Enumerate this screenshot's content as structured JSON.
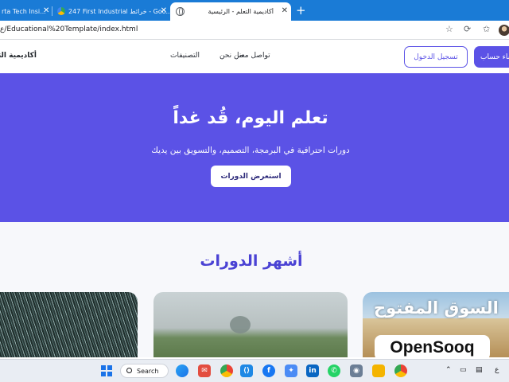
{
  "browser": {
    "tabs": [
      {
        "title": "rta Tech Insi...",
        "active": false
      },
      {
        "title": "247 First Industrial خرائط - Goo...",
        "active": false
      },
      {
        "title": "أكاديمية التعلم - الرئيسية",
        "active": true
      }
    ],
    "new_tab_label": "+",
    "url": "ع/Educational%20Template/index.html",
    "accent": "#1a7bd6"
  },
  "site": {
    "brand": "أكاديمية التعلم",
    "nav": [
      "تواصل معنا",
      "من نحن",
      "التصنيفات"
    ],
    "login_label": "تسجيل الدخول",
    "signup_label": "إنشاء حساب",
    "primary_color": "#5b52e6"
  },
  "hero": {
    "title": "تعلم اليوم، قُد غداً",
    "subtitle": "دورات احترافية في البرمجة، التصميم، والتسويق بين يديك",
    "cta_label": "استعرض الدورات"
  },
  "popular": {
    "title": "أشهر الدورات"
  },
  "watermark": {
    "arabic": "السوق المفتوح",
    "english": "OpenSooq"
  },
  "taskbar": {
    "search_label": "Search",
    "apps": [
      "copilot-icon",
      "mail-badge-icon",
      "chrome-icon",
      "vscode-icon",
      "facebook-icon",
      "maps-icon",
      "linkedin-icon",
      "whatsapp-icon",
      "camera-icon",
      "file-explorer-icon",
      "chrome-alt-icon"
    ],
    "tray_lang": "ع"
  }
}
